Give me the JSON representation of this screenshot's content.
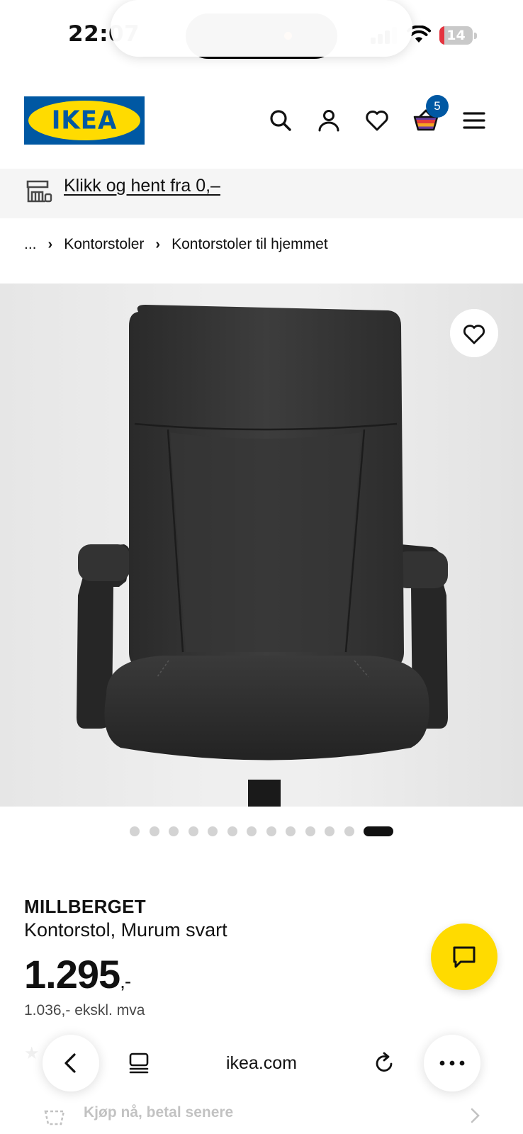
{
  "status_bar": {
    "time": "22:07",
    "battery": "14",
    "battery_level": 0.14
  },
  "header": {
    "logo_text": "IKEA",
    "cart_count": "5"
  },
  "promo": {
    "link_text": "Klikk og hent fra 0,–"
  },
  "breadcrumb": {
    "items": [
      "...",
      "Kontorstoler",
      "Kontorstoler til hjemmet"
    ]
  },
  "product": {
    "name": "MILLBERGET",
    "description": "Kontorstol, Murum svart",
    "price_main": "1.295",
    "price_suffix": ",-",
    "price_ex_vat": "1.036,- ekskl. mva",
    "image_count": 13,
    "active_image_index": 12
  },
  "browser": {
    "url": "ikea.com"
  },
  "bnpl": {
    "text": "Kjøp nå, betal senere"
  },
  "colors": {
    "ikea_blue": "#0058a3",
    "ikea_yellow": "#ffdb00",
    "battery_low": "#e4343f"
  },
  "icons": [
    "search-icon",
    "account-icon",
    "heart-icon",
    "cart-icon",
    "menu-icon",
    "store-icon",
    "chat-icon",
    "back-icon",
    "tabs-icon",
    "reload-icon",
    "more-icon",
    "star-icon",
    "bnpl-icon",
    "chevron-right-icon"
  ]
}
